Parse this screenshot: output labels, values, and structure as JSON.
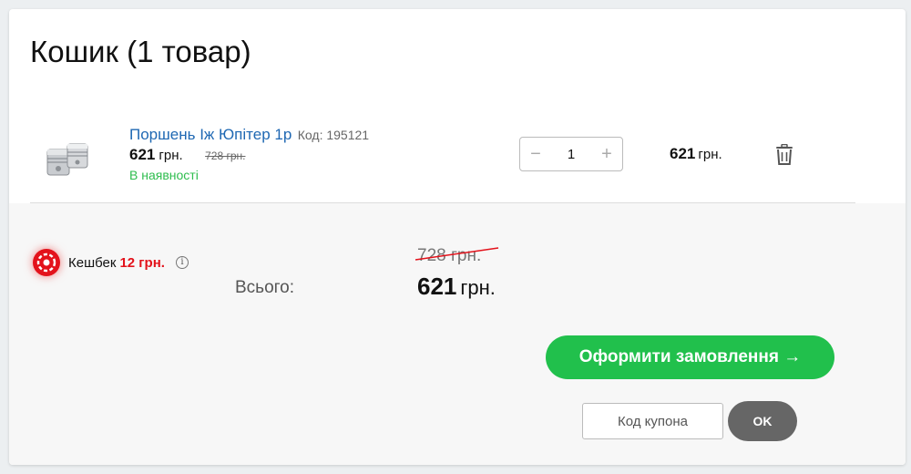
{
  "cart": {
    "title": "Кошик (1 товар)"
  },
  "item": {
    "name": "Поршень Іж Юпітер 1р",
    "code_label": "Код: 195121",
    "price": "621",
    "currency": "грн.",
    "old_price": "728 грн.",
    "stock": "В наявності",
    "quantity": "1",
    "minus_label": "−",
    "plus_label": "+",
    "line_total": "621",
    "line_total_currency": "грн.",
    "thumbnail_icon": "piston-image",
    "delete_icon": "trash-icon"
  },
  "summary": {
    "cashback_label": "Кешбек",
    "cashback_value": "12 грн.",
    "info_glyph": "i",
    "total_label": "Всього:",
    "total_old": "728 грн.",
    "total_new": "621",
    "total_currency": "грн."
  },
  "actions": {
    "checkout_label": "Оформити замовлення →",
    "coupon_placeholder": "Код купона",
    "ok_label": "OK"
  },
  "colors": {
    "accent_green": "#21c04c",
    "link_blue": "#1f68b3",
    "cashback_red": "#e3121b",
    "ok_button": "#666666"
  }
}
